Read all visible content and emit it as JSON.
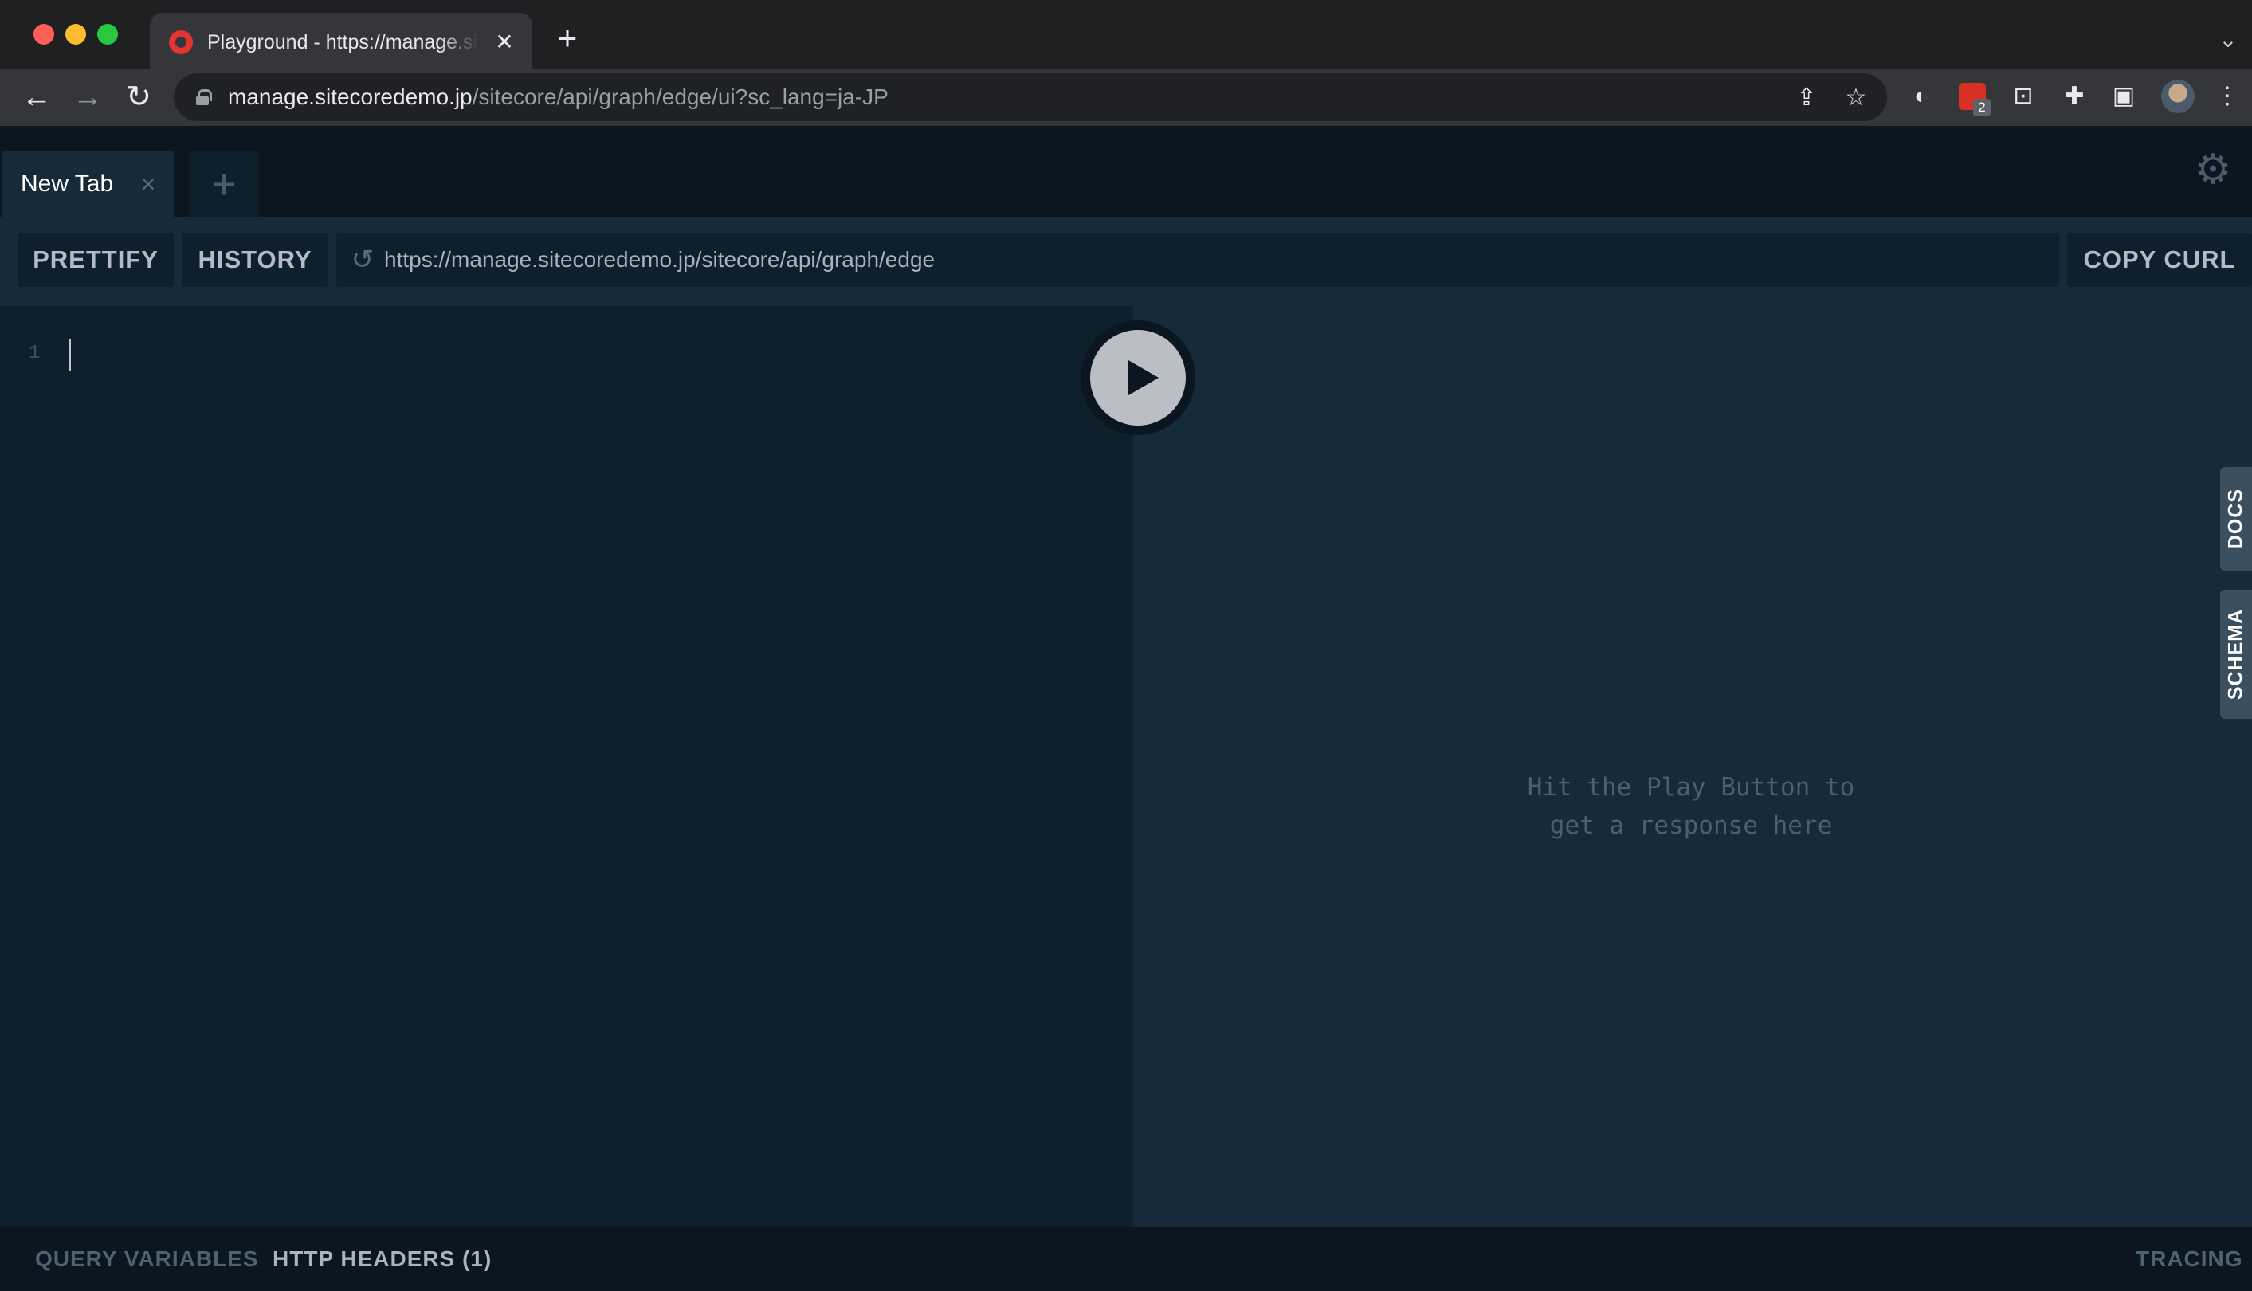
{
  "browser": {
    "tab_title": "Playground - https://manage.sitecoredemo.jp/sitecore/api/graph/edge/ui?sc_lang=ja-JP",
    "new_tab_symbol": "+",
    "tab_close_symbol": "✕",
    "url_host": "manage.sitecoredemo.jp",
    "url_path": "/sitecore/api/graph/edge/ui?sc_lang=ja-JP",
    "extension_badge_count": "2"
  },
  "playground": {
    "tabs": [
      {
        "label": "New Tab",
        "close_symbol": "×"
      }
    ],
    "add_tab_symbol": "+",
    "toolbar": {
      "prettify_label": "PRETTIFY",
      "history_label": "HISTORY",
      "endpoint_url": "https://manage.sitecoredemo.jp/sitecore/api/graph/edge",
      "copy_curl_label": "COPY CURL"
    },
    "editor": {
      "line_numbers": [
        "1"
      ]
    },
    "result": {
      "hint_line1": "Hit the Play Button to",
      "hint_line2": "get a response here"
    },
    "side_tabs": {
      "docs_label": "DOCS",
      "schema_label": "SCHEMA"
    },
    "bottom": {
      "query_variables_label": "QUERY VARIABLES",
      "http_headers_label": "HTTP HEADERS (1)",
      "tracing_label": "TRACING"
    }
  },
  "colors": {
    "app_background": "#0b1621",
    "editor_background": "#0f202d",
    "result_background": "#172a3a",
    "side_tab": "#3b4f5f",
    "play_button": "#b9bfc4"
  },
  "icons": [
    "back-arrow-icon",
    "forward-arrow-icon",
    "reload-icon",
    "lock-icon",
    "share-icon",
    "bookmark-star-icon",
    "extensions-puzzle-icon",
    "side-panel-icon",
    "kebab-menu-icon",
    "gear-icon",
    "play-icon",
    "history-reload-icon"
  ]
}
